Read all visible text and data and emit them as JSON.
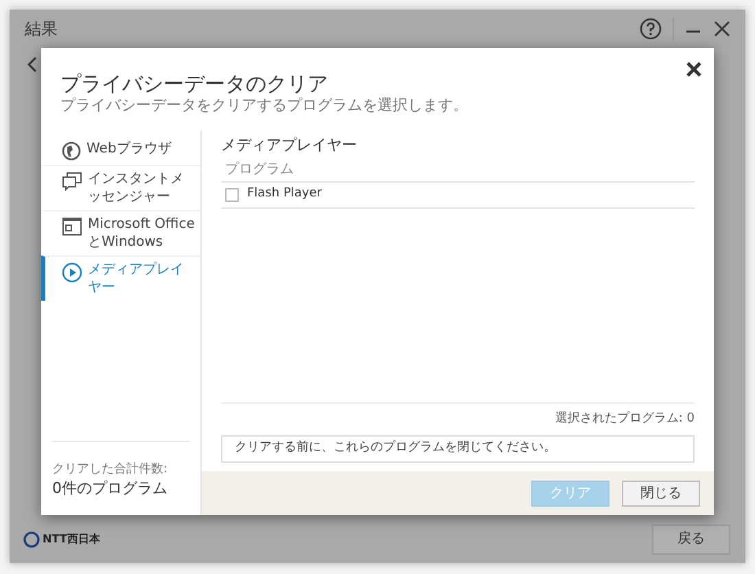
{
  "window": {
    "title": "結果"
  },
  "dialog": {
    "title": "プライバシーデータのクリア",
    "subtitle": "プライバシーデータをクリアするプログラムを選択します。"
  },
  "sidebar": {
    "items": [
      {
        "label": "Webブラウザ",
        "kind": "globe",
        "selected": false
      },
      {
        "label": "インスタントメッセンジャー",
        "kind": "chat",
        "selected": false
      },
      {
        "label": "Microsoft OfficeとWindows",
        "kind": "window",
        "selected": false
      },
      {
        "label": "メディアプレイヤー",
        "kind": "play",
        "selected": true
      }
    ],
    "total_label": "クリアした合計件数:",
    "total_value": "0件のプログラム"
  },
  "content": {
    "heading": "メディアプレイヤー",
    "column": "プログラム",
    "rows": [
      {
        "label": "Flash Player",
        "checked": false
      }
    ],
    "selected_count": "選択されたプログラム: 0",
    "notice": "クリアする前に、これらのプログラムを閉じてください。"
  },
  "buttons": [
    {
      "label": "クリア",
      "disabled": true
    },
    {
      "label": "閉じる",
      "disabled": false
    }
  ],
  "footer": {
    "logo": "NTT西日本",
    "back_button": "戻る"
  }
}
